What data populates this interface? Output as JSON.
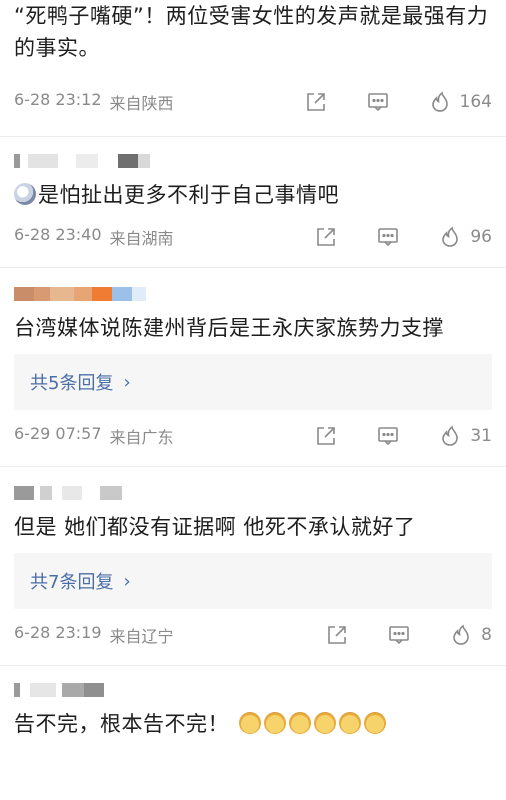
{
  "comments": [
    {
      "text": "“死鸭子嘴硬”！两位受害女性的发声就是最强有力的事实。",
      "time": "6-28 23:12",
      "location": "来自陕西",
      "likes": "164"
    },
    {
      "text": "是怕扯出更多不利于自己事情吧",
      "time": "6-28 23:40",
      "location": "来自湖南",
      "likes": "96"
    },
    {
      "text": "台湾媒体说陈建州背后是王永庆家族势力支撑",
      "replies": "共5条回复",
      "time": "6-29 07:57",
      "location": "来自广东",
      "likes": "31"
    },
    {
      "text": "但是 她们都没有证据啊 他死不承认就好了",
      "replies": "共7条回复",
      "time": "6-28 23:19",
      "location": "来自辽宁",
      "likes": "8"
    },
    {
      "text": "告不完，根本告不完！"
    }
  ],
  "icons": {
    "share": "share-icon",
    "comment": "comment-icon",
    "like": "flame-icon",
    "chevron": "chevron-right-icon",
    "reply_chevron": "›"
  }
}
